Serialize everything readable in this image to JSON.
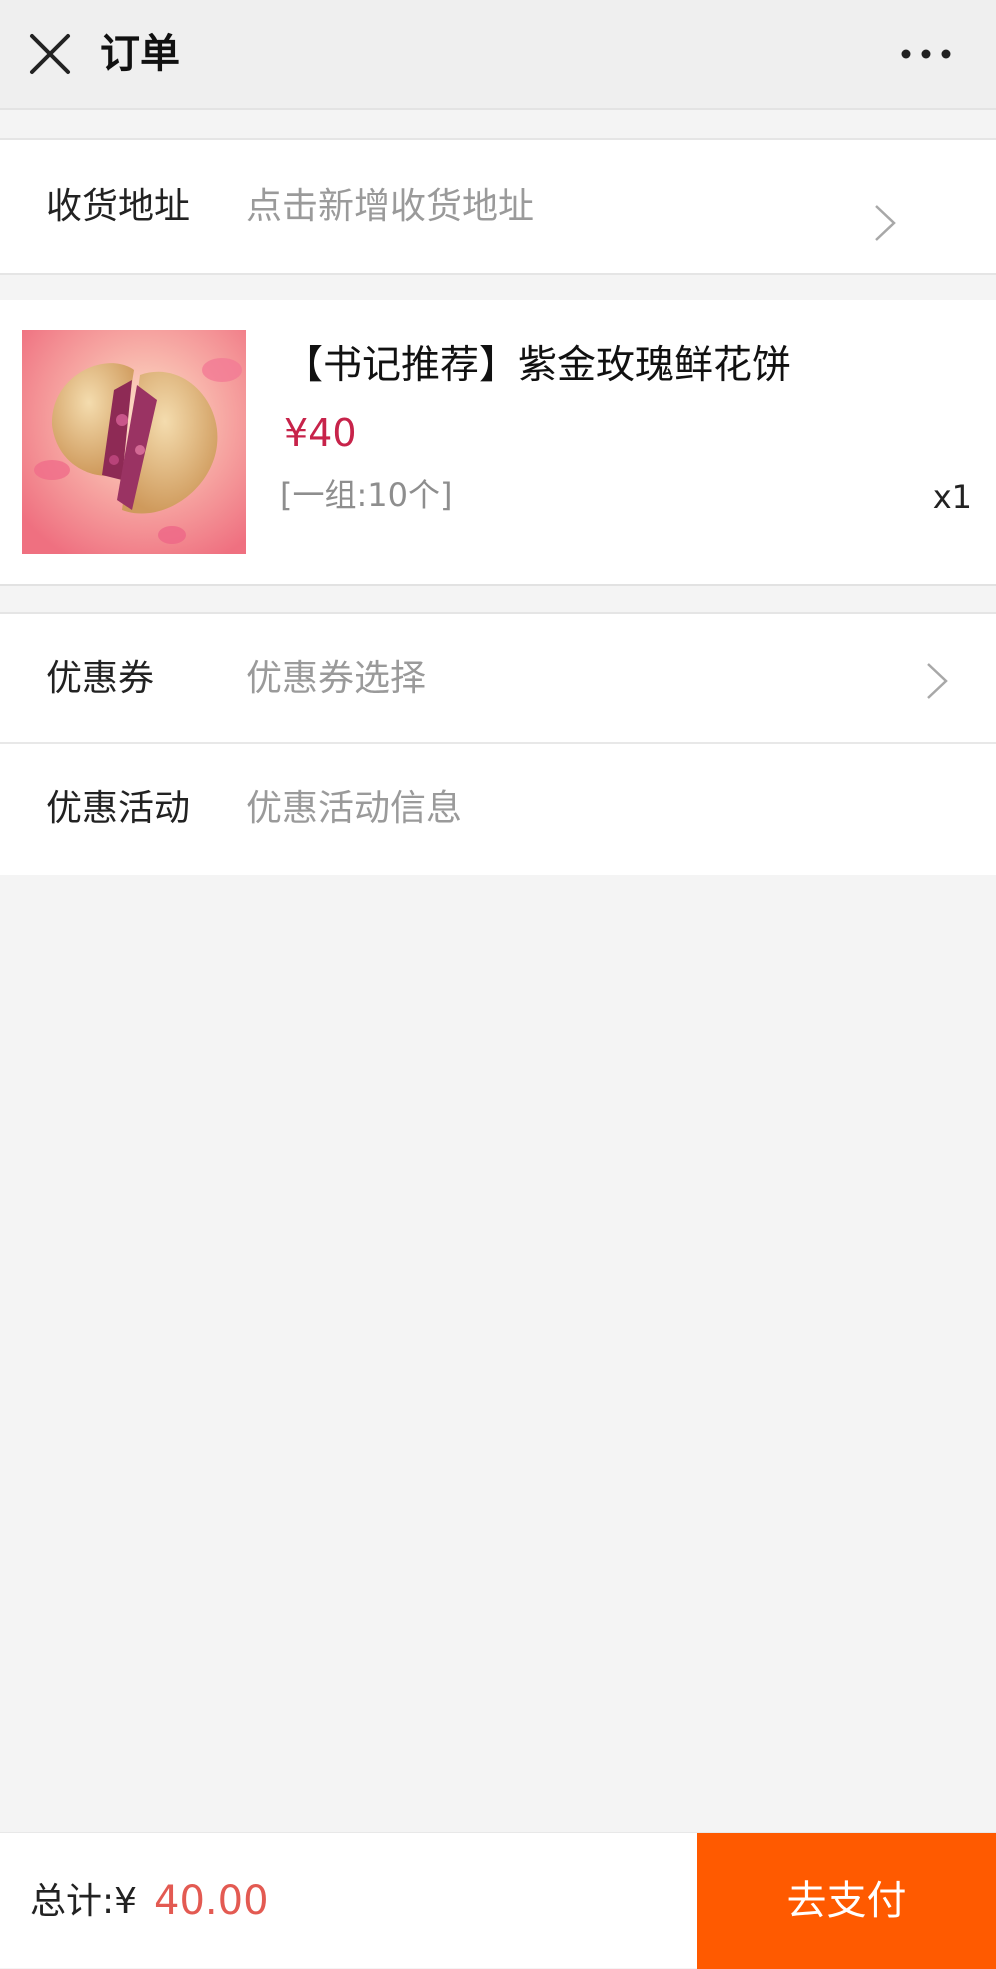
{
  "header": {
    "title": "订单",
    "close_icon": "close-icon",
    "more_icon": "more-dots-icon"
  },
  "address": {
    "label": "收货地址",
    "placeholder": "点击新增收货地址",
    "icon": "chevron-right-icon"
  },
  "product": {
    "name": "【书记推荐】紫金玫瑰鲜花饼",
    "price": "¥40",
    "spec": "[一组:10个]",
    "quantity": "x1",
    "image_icon": "rose-flower-cake-image"
  },
  "coupon": {
    "label": "优惠券",
    "value": "优惠券选择",
    "icon": "chevron-right-icon"
  },
  "promotion": {
    "label": "优惠活动",
    "value": "优惠活动信息"
  },
  "footer": {
    "total_label": "总计:¥",
    "total_value": "40.00",
    "pay_label": "去支付"
  },
  "colors": {
    "accent": "#ff5a00",
    "price": "#c7234a",
    "total": "#e35a52"
  }
}
